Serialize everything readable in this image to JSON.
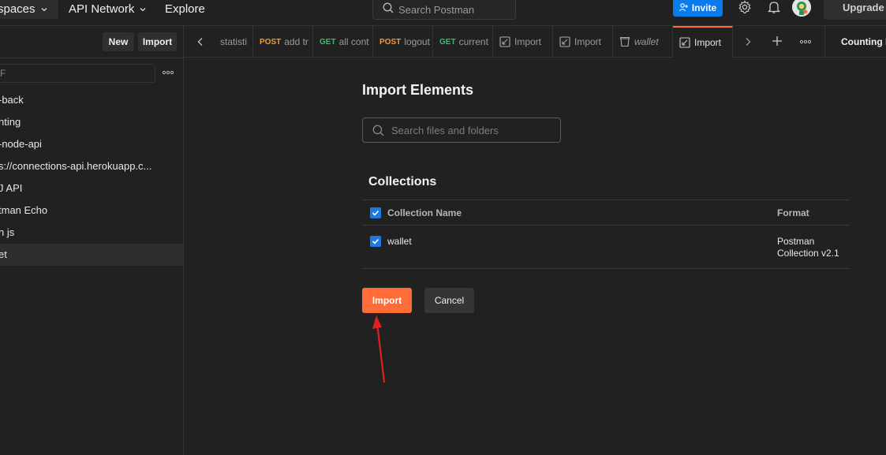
{
  "topbar": {
    "workspaces_label": "spaces",
    "api_network_label": "API Network",
    "explore_label": "Explore",
    "search_text": "Search Postman",
    "invite_label": "Invite",
    "upgrade_label": "Upgrade"
  },
  "sidebar": {
    "new_label": "New",
    "import_label": "Import",
    "filter_value": "F",
    "items": [
      {
        "label": "-back",
        "active": false
      },
      {
        "label": "nting",
        "active": false
      },
      {
        "label": "-node-api",
        "active": false
      },
      {
        "label": "s://connections-api.herokuapp.c...",
        "active": false
      },
      {
        "label": "J API",
        "active": false
      },
      {
        "label": "tman Echo",
        "active": false
      },
      {
        "label": "n js",
        "active": false
      },
      {
        "label": "et",
        "active": true
      }
    ]
  },
  "tabs": {
    "items": [
      {
        "method": "",
        "label": "statisti"
      },
      {
        "method": "POST",
        "label": "add tr"
      },
      {
        "method": "GET",
        "label": "all cont"
      },
      {
        "method": "POST",
        "label": "logout"
      },
      {
        "method": "GET",
        "label": "current"
      },
      {
        "method": "",
        "label": "Import"
      },
      {
        "method": "",
        "label": "Import"
      },
      {
        "method": "",
        "label": "wallet"
      },
      {
        "method": "",
        "label": "Import"
      }
    ],
    "environment": "Counting E"
  },
  "import_panel": {
    "title": "Import Elements",
    "search_placeholder": "Search files and folders",
    "section_title": "Collections",
    "col_name_header": "Collection Name",
    "col_format_header": "Format",
    "rows": [
      {
        "name": "wallet",
        "format_line1": "Postman",
        "format_line2": "Collection v2.1",
        "checked": true
      }
    ],
    "import_button": "Import",
    "cancel_button": "Cancel"
  },
  "colors": {
    "accent_orange": "#ff6c37",
    "accent_blue": "#097bed",
    "background": "#212121"
  }
}
